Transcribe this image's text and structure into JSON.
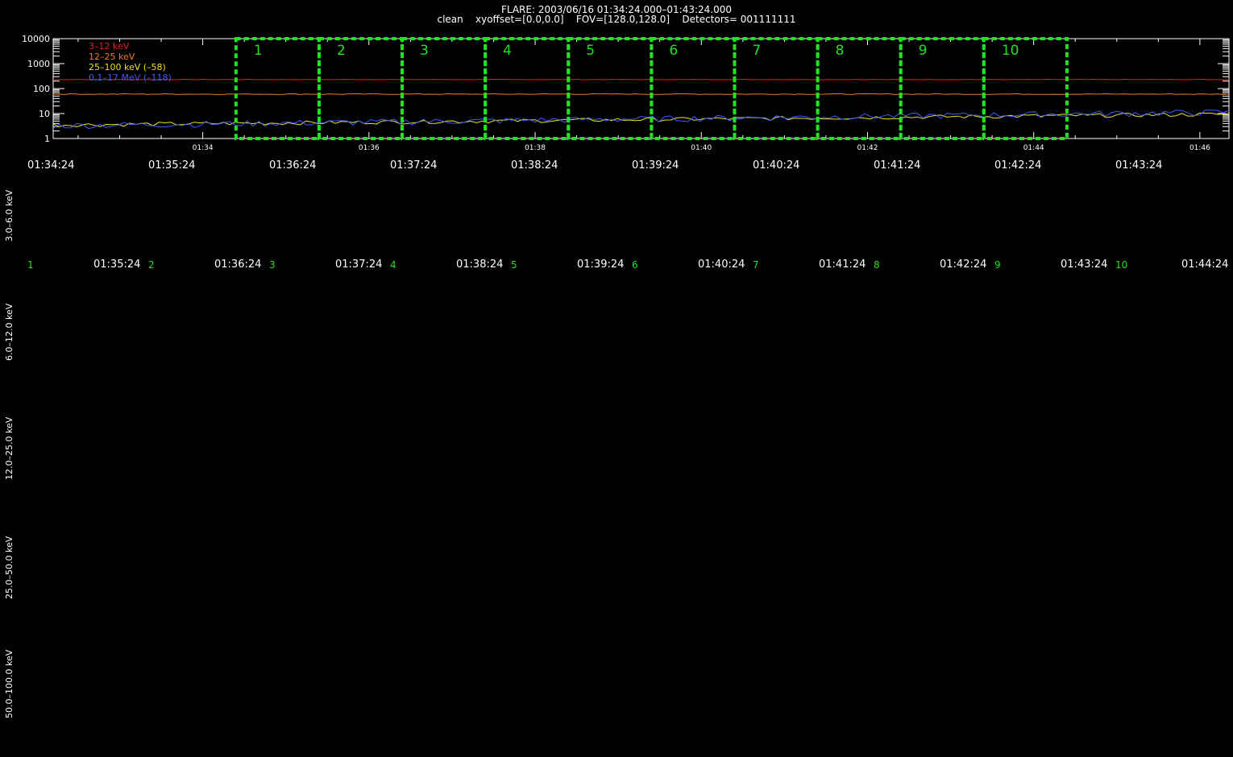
{
  "header": {
    "title": "FLARE: 2003/06/16 01:34:24.000–01:43:24.000",
    "subtitle": "clean    xyoffset=[0.0,0.0]    FOV=[128.0,128.0]    Detectors= 001111111"
  },
  "chart_data": {
    "type": "line",
    "title": "",
    "y_scale": "log",
    "ylim": [
      1,
      10000
    ],
    "y_ticks": [
      "10000",
      "1000",
      "100",
      "10",
      "1"
    ],
    "x_tick_labels": [
      "01:34",
      "01:36",
      "01:38",
      "01:40",
      "01:42",
      "01:44",
      "01:46"
    ],
    "x_tick_minutes": [
      34,
      36,
      38,
      40,
      42,
      44,
      46
    ],
    "xlim_minutes": [
      32.2,
      46.35
    ],
    "legend_position": "top-left",
    "series": [
      {
        "name": "3–12 keV",
        "color": "#e02020",
        "level": 230,
        "jitter": 0.02
      },
      {
        "name": "12–25 keV",
        "color": "#f07c1c",
        "level": 60,
        "jitter": 0.04
      },
      {
        "name": "25–100 keV (–58)",
        "color": "#f0e020",
        "start": 3.5,
        "end": 9.5,
        "jitter": 0.18
      },
      {
        "name": "0.1–17 MeV (–118)",
        "color": "#3a5cff",
        "start": 3.3,
        "end": 11.5,
        "jitter": 0.28
      }
    ],
    "intervals": [
      {
        "label": "1",
        "start_min": 34.4,
        "end_min": 35.4
      },
      {
        "label": "2",
        "start_min": 35.4,
        "end_min": 36.4
      },
      {
        "label": "3",
        "start_min": 36.4,
        "end_min": 37.4
      },
      {
        "label": "4",
        "start_min": 37.4,
        "end_min": 38.4
      },
      {
        "label": "5",
        "start_min": 38.4,
        "end_min": 39.4
      },
      {
        "label": "6",
        "start_min": 39.4,
        "end_min": 40.4
      },
      {
        "label": "7",
        "start_min": 40.4,
        "end_min": 41.4
      },
      {
        "label": "8",
        "start_min": 41.4,
        "end_min": 42.4
      },
      {
        "label": "9",
        "start_min": 42.4,
        "end_min": 43.4
      },
      {
        "label": "10",
        "start_min": 43.4,
        "end_min": 44.4
      }
    ],
    "interval_color": "#22e022"
  },
  "interval_times": [
    "01:34:24",
    "01:35:24",
    "01:36:24",
    "01:37:24",
    "01:38:24",
    "01:39:24",
    "01:40:24",
    "01:41:24",
    "01:42:24",
    "01:43:24"
  ],
  "interval_end_times": [
    "01:35:24",
    "01:36:24",
    "01:37:24",
    "01:38:24",
    "01:39:24",
    "01:40:24",
    "01:41:24",
    "01:42:24",
    "01:43:24",
    "01:44:24"
  ],
  "interval_numbers": [
    "1",
    "2",
    "3",
    "4",
    "5",
    "6",
    "7",
    "8",
    "9",
    "10"
  ],
  "energy_bands": [
    "3.0–6.0 keV",
    "6.0–12.0 keV",
    "12.0–25.0 keV",
    "25.0–50.0 keV",
    "50.0–100.0 keV"
  ]
}
